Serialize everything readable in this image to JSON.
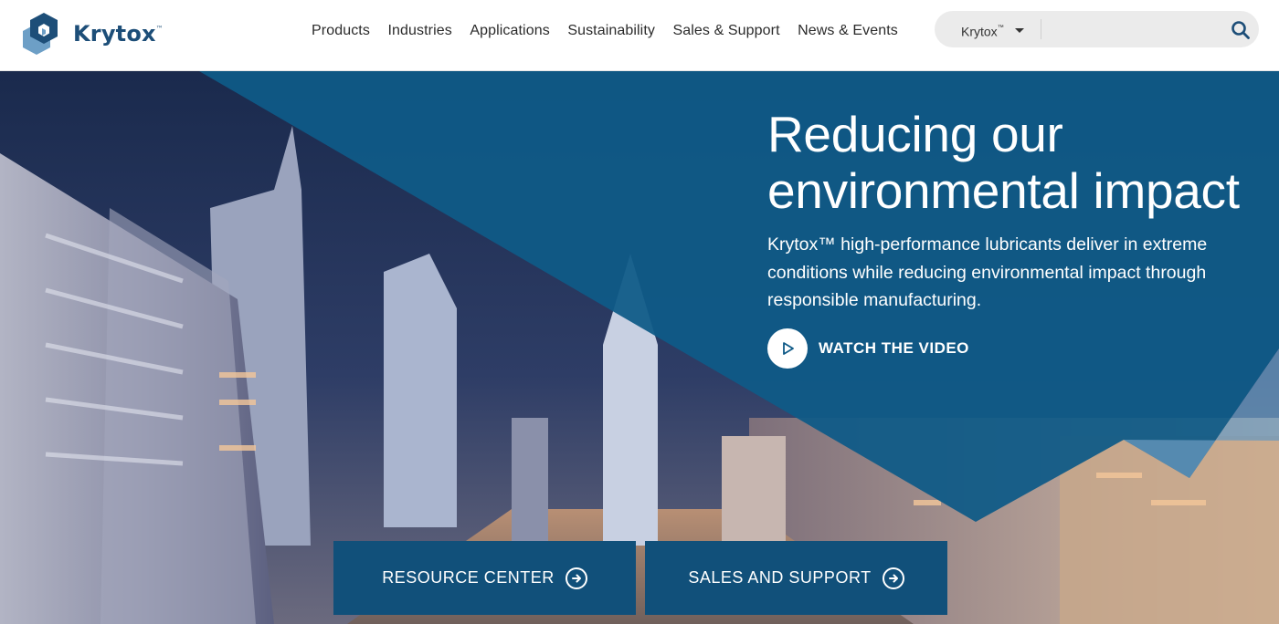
{
  "brand": {
    "name": "Krytox",
    "tm": "™"
  },
  "nav": [
    {
      "label": "Products"
    },
    {
      "label": "Industries"
    },
    {
      "label": "Applications"
    },
    {
      "label": "Sustainability"
    },
    {
      "label": "Sales & Support"
    },
    {
      "label": "News & Events"
    }
  ],
  "search": {
    "scope_label": "Krytox",
    "scope_tm": "™",
    "placeholder": "",
    "value": ""
  },
  "hero": {
    "title_line1": "Reducing our",
    "title_line2": "environmental impact",
    "description": "Krytox™ high-performance lubricants deliver in extreme conditions while reducing environmental impact through responsible manufacturing.",
    "video_label": "WATCH THE VIDEO"
  },
  "cta": {
    "resource_center": "RESOURCE CENTER",
    "sales_support": "SALES AND SUPPORT"
  },
  "colors": {
    "brand_blue": "#1d4e78",
    "hero_panel": "#0f5a87",
    "cta_bg": "#11507a"
  }
}
